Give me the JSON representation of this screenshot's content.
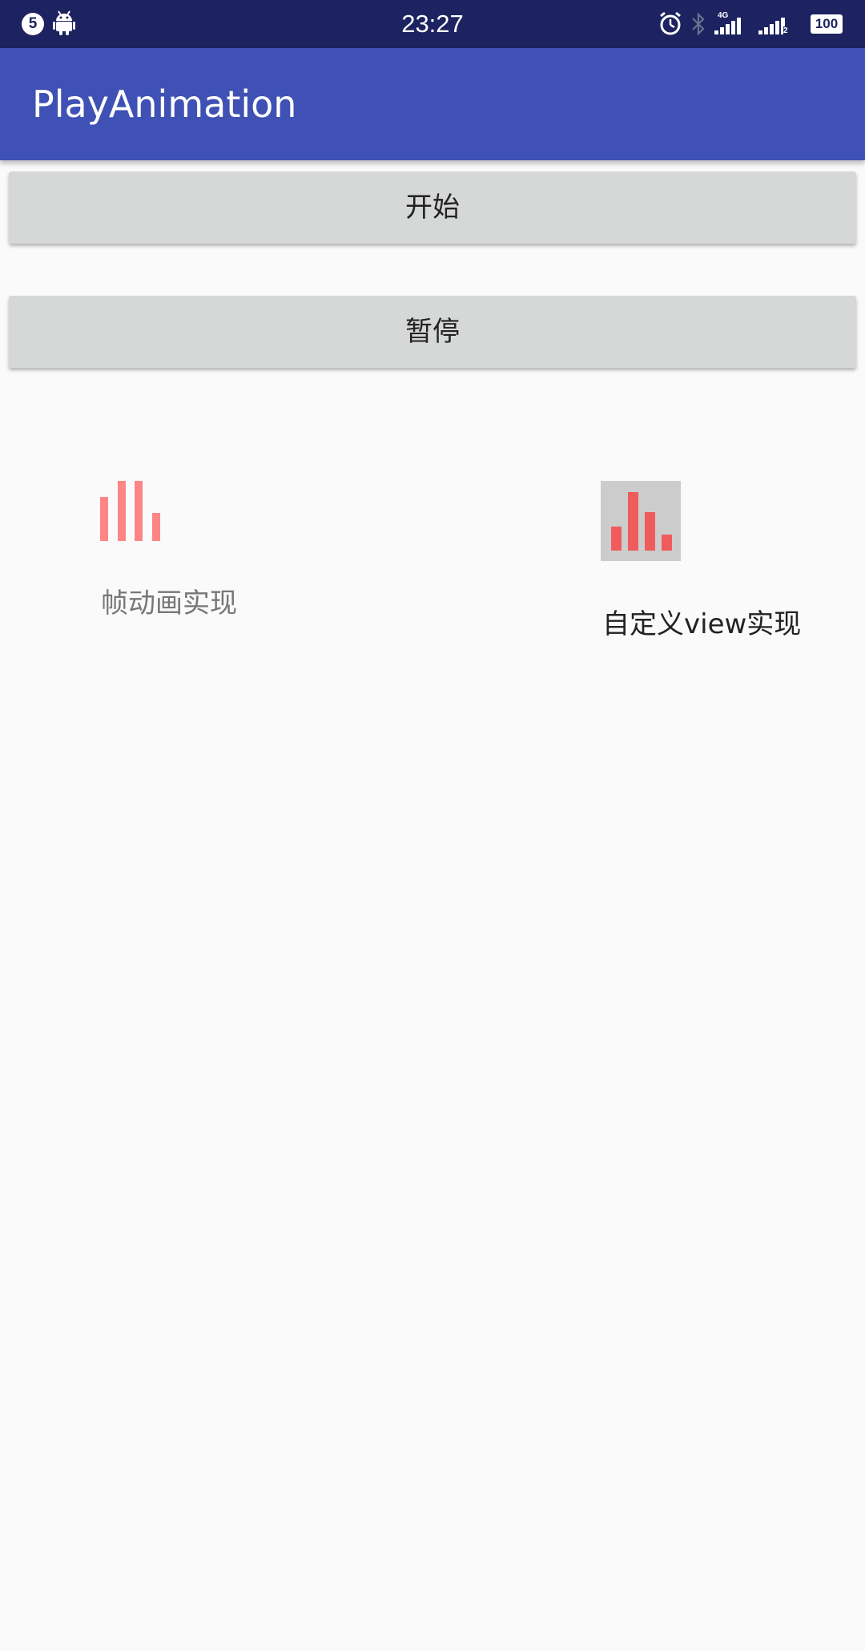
{
  "status_bar": {
    "notification_count": "5",
    "time": "23:27",
    "network_label_1": "4G",
    "sim2_label": "2",
    "battery": "100",
    "icons": [
      "android-icon",
      "alarm-icon",
      "bluetooth-icon",
      "signal-icon",
      "signal-icon",
      "battery-icon"
    ]
  },
  "app_bar": {
    "title": "PlayAnimation"
  },
  "buttons": {
    "start_label": "开始",
    "pause_label": "暂停"
  },
  "demos": {
    "frame_animation_label": "帧动画实现",
    "custom_view_label": "自定义view实现"
  },
  "colors": {
    "status_bar": "#1c2360",
    "app_bar": "#3f51b5",
    "button": "#d6d7d7",
    "frame_bars": "#fe8585",
    "custom_view_bg": "#cccccc",
    "custom_view_bars": "#f05b5b"
  }
}
